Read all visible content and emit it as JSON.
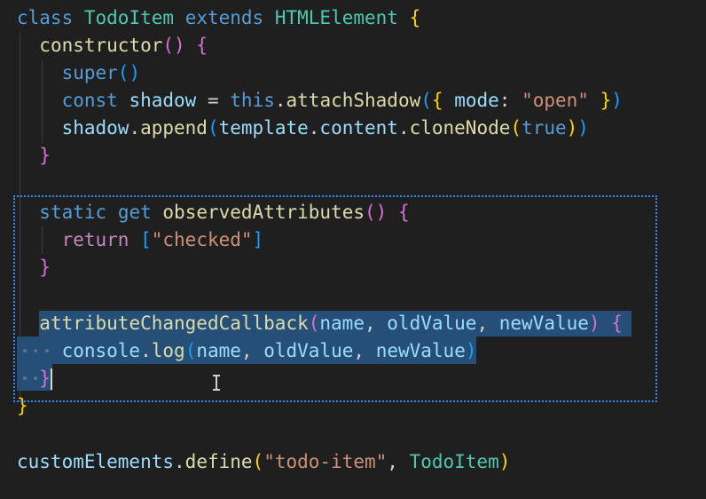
{
  "code": {
    "line1": {
      "kw_class": "class",
      "name": "TodoItem",
      "kw_extends": "extends",
      "base": "HTMLElement",
      "brace": "{"
    },
    "line2": {
      "name": "constructor",
      "parens": "()",
      "brace": "{"
    },
    "line3": {
      "name": "super",
      "parens": "()"
    },
    "line4": {
      "kw_const": "const",
      "var": "shadow",
      "eq": "=",
      "kw_this": "this",
      "dot": ".",
      "method": "attachShadow",
      "open_paren": "(",
      "open_brace": "{",
      "prop": "mode",
      "colon": ":",
      "str": "\"open\"",
      "close_brace": "}",
      "close_paren": ")"
    },
    "line5": {
      "obj": "shadow",
      "dot1": ".",
      "method": "append",
      "open_paren": "(",
      "tpl": "template",
      "dot2": ".",
      "content": "content",
      "dot3": ".",
      "clone": "cloneNode",
      "open_paren2": "(",
      "arg": "true",
      "close_paren2": ")",
      "close_paren": ")"
    },
    "line6": {
      "brace": "}"
    },
    "line8": {
      "kw_static": "static",
      "kw_get": "get",
      "name": "observedAttributes",
      "parens": "()",
      "brace": "{"
    },
    "line9": {
      "kw_return": "return",
      "open_bracket": "[",
      "str": "\"checked\"",
      "close_bracket": "]"
    },
    "line10": {
      "brace": "}"
    },
    "line12": {
      "name": "attributeChangedCallback",
      "open_paren": "(",
      "p1": "name",
      "c1": ",",
      "p2": "oldValue",
      "c2": ",",
      "p3": "newValue",
      "close_paren": ")",
      "brace": "{"
    },
    "line13": {
      "obj": "console",
      "dot": ".",
      "method": "log",
      "open_paren": "(",
      "a1": "name",
      "c1": ",",
      "a2": "oldValue",
      "c2": ",",
      "a3": "newValue",
      "close_paren": ")"
    },
    "line14": {
      "brace": "}"
    },
    "line15": {
      "brace": "}"
    },
    "line17": {
      "obj": "customElements",
      "dot": ".",
      "method": "define",
      "open_paren": "(",
      "str": "\"todo-item\"",
      "comma": ",",
      "arg": "TodoItem",
      "close_paren": ")"
    }
  },
  "colors": {
    "background": "#1f1f1f",
    "selection": "#264f78",
    "focus_outline": "#2f8cff",
    "keyword": "#569cd6",
    "class_name": "#4ec9b0",
    "function": "#dcdcaa",
    "variable": "#9cdcfe",
    "string": "#ce9178"
  },
  "icons": {
    "mouse_cursor": "text-ibeam-cursor-icon"
  }
}
